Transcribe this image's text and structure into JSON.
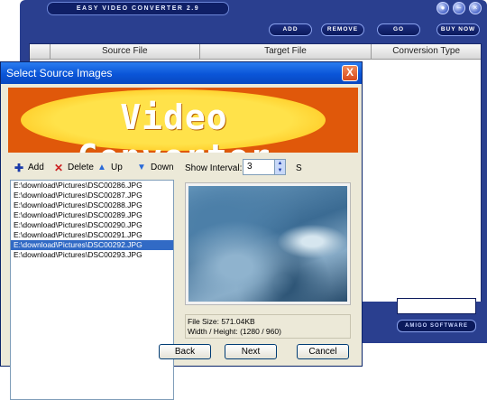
{
  "app": {
    "title": "EASY VIDEO CONVERTER 2.9",
    "toolbar": [
      "ADD",
      "REMOVE",
      "GO",
      "BUY NOW"
    ],
    "columns": [
      "Source File",
      "Target File",
      "Conversion Type"
    ],
    "brand": "AMIGO SOFTWARE"
  },
  "dialog": {
    "title": "Select Source Images",
    "close_label": "X",
    "banner": "Video Converter",
    "tools": {
      "add": "Add",
      "delete": "Delete",
      "up": "Up",
      "down": "Down"
    },
    "interval": {
      "label": "Show Interval:",
      "value": "3",
      "unit": "S"
    },
    "files": [
      "E:\\download\\Pictures\\DSC00286.JPG",
      "E:\\download\\Pictures\\DSC00287.JPG",
      "E:\\download\\Pictures\\DSC00288.JPG",
      "E:\\download\\Pictures\\DSC00289.JPG",
      "E:\\download\\Pictures\\DSC00290.JPG",
      "E:\\download\\Pictures\\DSC00291.JPG",
      "E:\\download\\Pictures\\DSC00292.JPG",
      "E:\\download\\Pictures\\DSC00293.JPG"
    ],
    "selected_index": 6,
    "info": {
      "size": "File Size:   571.04KB",
      "dims": "Width / Height:  (1280 / 960)"
    },
    "buttons": {
      "back": "Back",
      "next": "Next",
      "cancel": "Cancel"
    }
  },
  "colors": {
    "app_blue": "#2a3f8f",
    "titlebar_blue": "#0a55d8",
    "selection": "#316ac5",
    "banner_orange": "#e0580a",
    "banner_yellow": "#ffe24a"
  }
}
